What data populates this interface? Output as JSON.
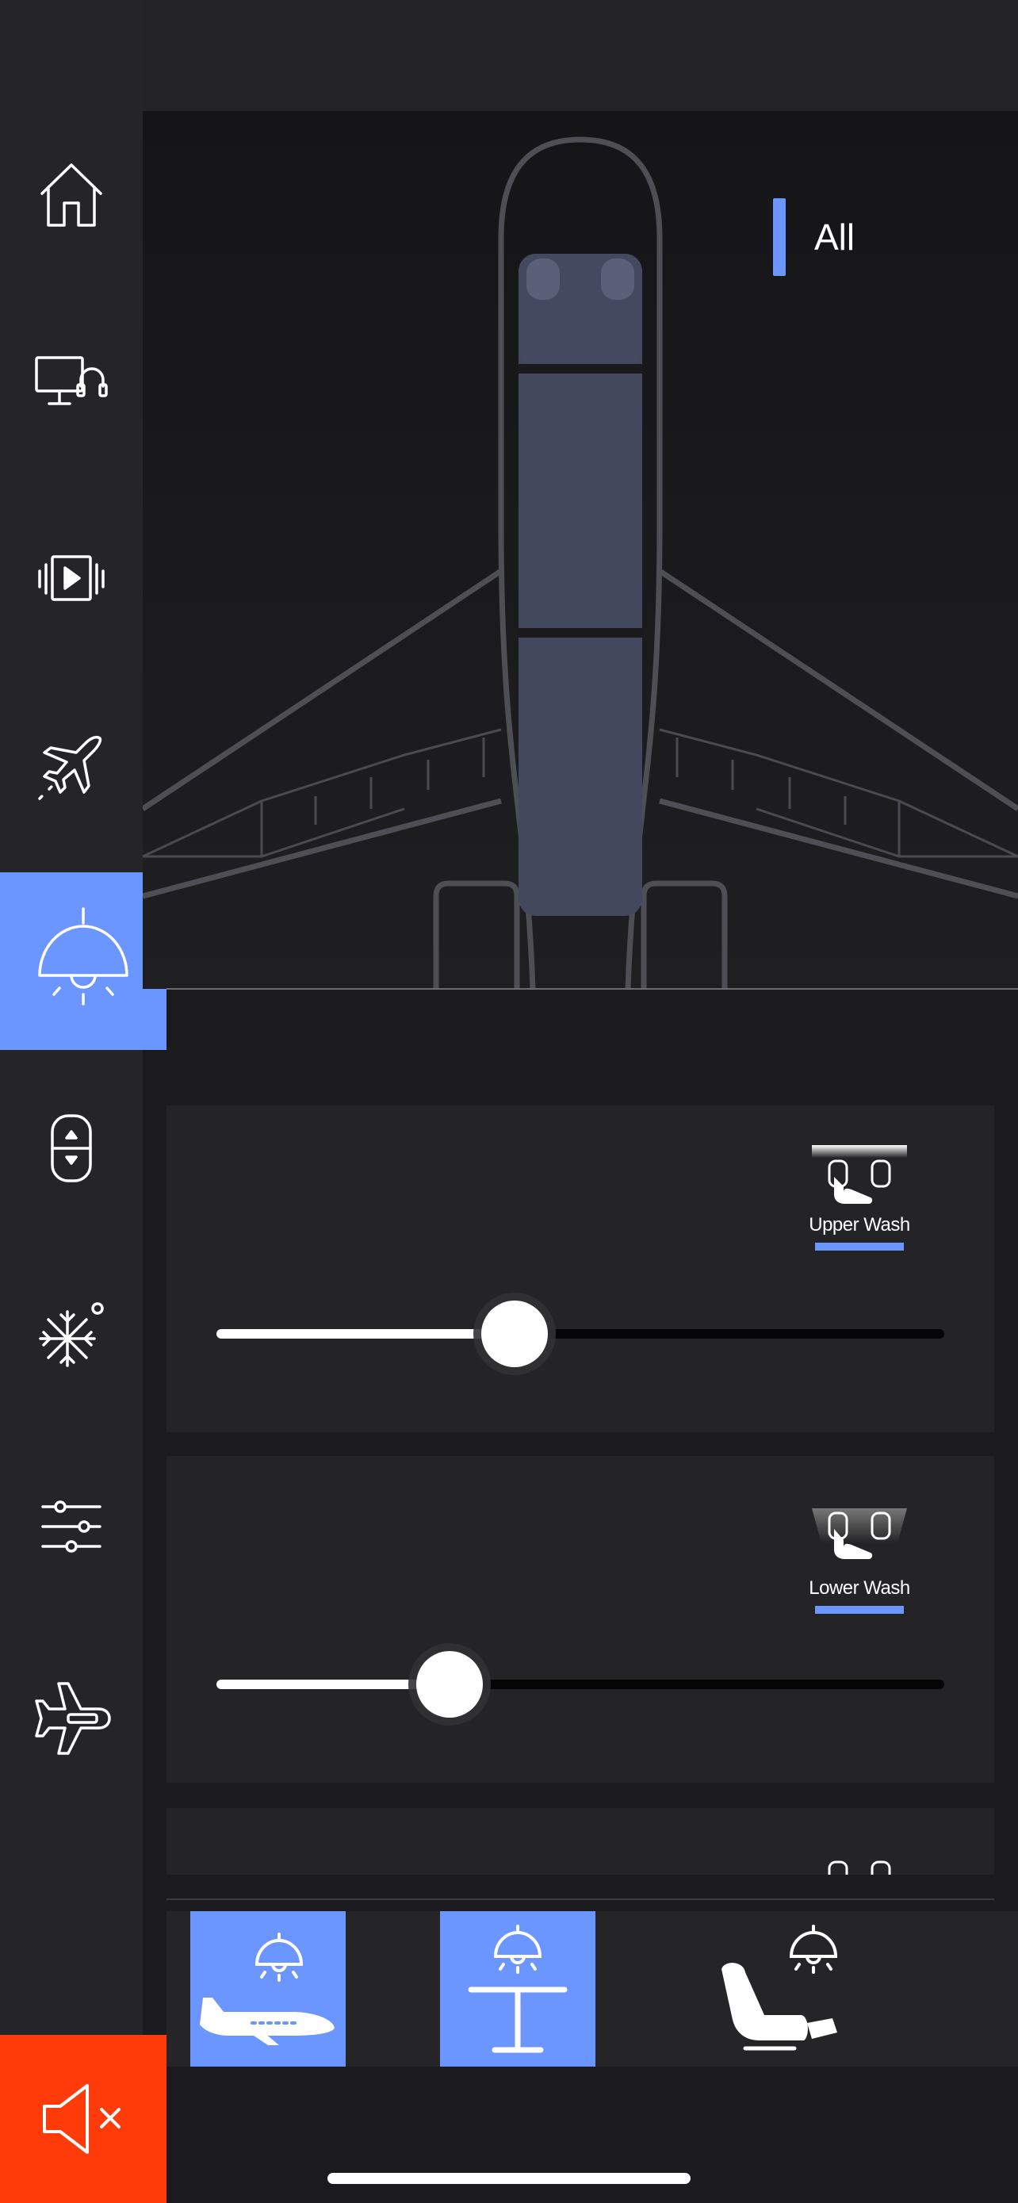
{
  "sidebar": {
    "items": [
      {
        "name": "nav-home",
        "icon": "home-icon",
        "active": false
      },
      {
        "name": "nav-media-audio",
        "icon": "monitor-headphones-icon",
        "active": false
      },
      {
        "name": "nav-video",
        "icon": "video-play-icon",
        "active": false
      },
      {
        "name": "nav-flight",
        "icon": "airplane-takeoff-icon",
        "active": false
      },
      {
        "name": "nav-lighting",
        "icon": "ceiling-lamp-icon",
        "active": true
      },
      {
        "name": "nav-window-shade",
        "icon": "shade-up-down-icon",
        "active": false
      },
      {
        "name": "nav-climate",
        "icon": "snowflake-icon",
        "active": false
      },
      {
        "name": "nav-settings",
        "icon": "sliders-icon",
        "active": false
      },
      {
        "name": "nav-cabin",
        "icon": "airplane-cabin-icon",
        "active": false
      }
    ],
    "mute_icon": "speaker-muted-icon"
  },
  "hero": {
    "zone_label": "All"
  },
  "panels": [
    {
      "label": "Upper Wash",
      "icon": "upper-wash-icon",
      "level_percent": 41
    },
    {
      "label": "Lower Wash",
      "icon": "lower-wash-icon",
      "level_percent": 32
    }
  ],
  "scenes": [
    {
      "name": "scene-aircraft-lighting",
      "icon": "aircraft-lamp-icon",
      "active": true
    },
    {
      "name": "scene-table-lighting",
      "icon": "table-lamp-icon",
      "active": true
    },
    {
      "name": "scene-seat-lighting",
      "icon": "seat-lamp-icon",
      "active": false
    }
  ],
  "colors": {
    "accent": "#6b95ff",
    "mute": "#ff3b0a",
    "background": "#1b1b1d",
    "panel": "#242426"
  }
}
